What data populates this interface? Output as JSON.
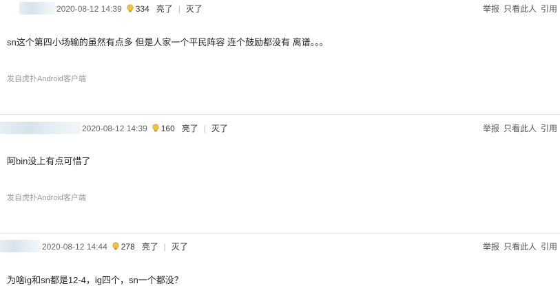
{
  "posts": [
    {
      "time": "2020-08-12 14:39",
      "light_count": "334",
      "like_label": "亮了",
      "dislike_label": "灭了",
      "separator": "|",
      "content": "sn这个第四小场输的虽然有点多 但是人家一个平民阵容 连个鼓励都没有 离谱。。。",
      "source": "发自虎扑Android客户端",
      "actions": [
        "举报",
        "只看此人",
        "引用"
      ]
    },
    {
      "time": "2020-08-12 14:39",
      "light_count": "160",
      "like_label": "亮了",
      "dislike_label": "灭了",
      "separator": "|",
      "content": "阿bin没上有点可惜了",
      "source": "发自虎扑Android客户端",
      "actions": [
        "举报",
        "只看此人",
        "引用"
      ]
    },
    {
      "time": "2020-08-12 14:44",
      "light_count": "278",
      "like_label": "亮了",
      "dislike_label": "灭了",
      "separator": "|",
      "content": "为啥ig和sn都是12-4，ig四个，sn一个都没？",
      "actions": [
        "举报",
        "只看此人",
        "引用"
      ]
    }
  ],
  "icon": "lightbulb-icon"
}
